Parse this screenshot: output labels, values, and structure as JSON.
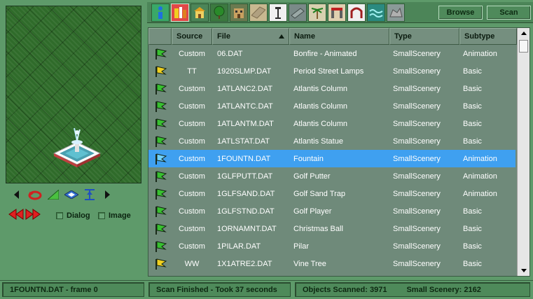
{
  "toolbar": {
    "tools": [
      {
        "icon": "info-icon",
        "active": false
      },
      {
        "icon": "rides-icon",
        "active": true
      },
      {
        "icon": "shop-icon",
        "active": false
      },
      {
        "icon": "tree-icon",
        "active": false
      },
      {
        "icon": "building-icon",
        "active": false
      },
      {
        "icon": "path-icon",
        "active": false
      },
      {
        "icon": "lamp-icon",
        "active": false
      },
      {
        "icon": "fence-icon",
        "active": false
      },
      {
        "icon": "palm-icon",
        "active": false
      },
      {
        "icon": "park-entrance-icon",
        "active": false
      },
      {
        "icon": "gate-icon",
        "active": false
      },
      {
        "icon": "water-icon",
        "active": false
      },
      {
        "icon": "rock-icon",
        "active": false
      }
    ],
    "browse_label": "Browse",
    "scan_label": "Scan"
  },
  "preview": {
    "dialog_label": "Dialog",
    "image_label": "Image"
  },
  "table": {
    "columns": [
      "Source",
      "File",
      "Name",
      "Type",
      "Subtype"
    ],
    "sorted_column": "File",
    "rows": [
      {
        "icon": "green-flag-icon",
        "source": "Custom",
        "file": "06.DAT",
        "name": "Bonfire - Animated",
        "type": "SmallScenery",
        "subtype": "Animation",
        "selected": false
      },
      {
        "icon": "yellow-flag-icon",
        "source": "TT",
        "file": "1920SLMP.DAT",
        "name": "Period Street Lamps",
        "type": "SmallScenery",
        "subtype": "Basic",
        "selected": false
      },
      {
        "icon": "green-flag-icon",
        "source": "Custom",
        "file": "1ATLANC2.DAT",
        "name": "Atlantis Column",
        "type": "SmallScenery",
        "subtype": "Basic",
        "selected": false
      },
      {
        "icon": "green-flag-icon",
        "source": "Custom",
        "file": "1ATLANTC.DAT",
        "name": "Atlantis Column",
        "type": "SmallScenery",
        "subtype": "Basic",
        "selected": false
      },
      {
        "icon": "green-flag-icon",
        "source": "Custom",
        "file": "1ATLANTM.DAT",
        "name": "Atlantis Column",
        "type": "SmallScenery",
        "subtype": "Basic",
        "selected": false
      },
      {
        "icon": "green-flag-icon",
        "source": "Custom",
        "file": "1ATLSTAT.DAT",
        "name": "Atlantis Statue",
        "type": "SmallScenery",
        "subtype": "Basic",
        "selected": false
      },
      {
        "icon": "green-flag-icon",
        "source": "Custom",
        "file": "1FOUNTN.DAT",
        "name": "Fountain",
        "type": "SmallScenery",
        "subtype": "Animation",
        "selected": true
      },
      {
        "icon": "green-flag-icon",
        "source": "Custom",
        "file": "1GLFPUTT.DAT",
        "name": "Golf Putter",
        "type": "SmallScenery",
        "subtype": "Animation",
        "selected": false
      },
      {
        "icon": "green-flag-icon",
        "source": "Custom",
        "file": "1GLFSAND.DAT",
        "name": "Golf Sand Trap",
        "type": "SmallScenery",
        "subtype": "Animation",
        "selected": false
      },
      {
        "icon": "green-flag-icon",
        "source": "Custom",
        "file": "1GLFSTND.DAT",
        "name": "Golf Player",
        "type": "SmallScenery",
        "subtype": "Basic",
        "selected": false
      },
      {
        "icon": "green-flag-icon",
        "source": "Custom",
        "file": "1ORNAMNT.DAT",
        "name": "Christmas Ball",
        "type": "SmallScenery",
        "subtype": "Basic",
        "selected": false
      },
      {
        "icon": "green-flag-icon",
        "source": "Custom",
        "file": "1PILAR.DAT",
        "name": "Pilar",
        "type": "SmallScenery",
        "subtype": "Basic",
        "selected": false
      },
      {
        "icon": "yellow-flag-icon",
        "source": "WW",
        "file": "1X1ATRE2.DAT",
        "name": "Vine Tree",
        "type": "SmallScenery",
        "subtype": "Basic",
        "selected": false
      }
    ]
  },
  "status": {
    "left": "1FOUNTN.DAT - frame 0",
    "middle": "Scan Finished - Took 37 seconds",
    "objects_scanned": "Objects Scanned: 3971",
    "small_scenery": "Small Scenery: 2162"
  },
  "colors": {
    "window_bg": "#5e9a6a",
    "table_bg": "#6f8a7a",
    "selection": "#3fa0f0",
    "green_flag": "#38c030",
    "yellow_flag": "#f0d020"
  }
}
